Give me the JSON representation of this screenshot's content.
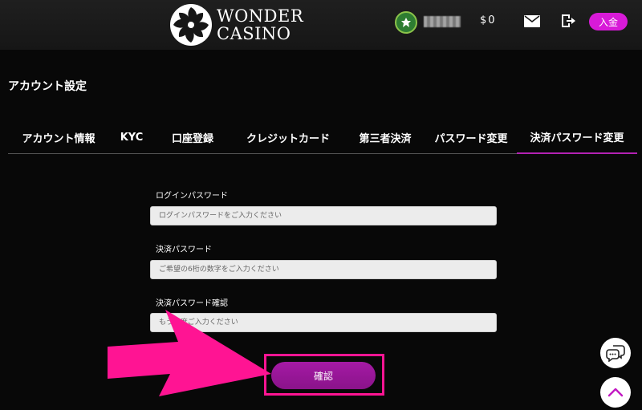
{
  "header": {
    "logo_line1": "WONDER",
    "logo_line2": "CASINO",
    "balance": "$0",
    "deposit_label": "入金"
  },
  "page": {
    "title": "アカウント設定"
  },
  "tabs": [
    {
      "label": "アカウント情報",
      "active": false
    },
    {
      "label": "KYC",
      "active": false
    },
    {
      "label": "口座登録",
      "active": false
    },
    {
      "label": "クレジットカード",
      "active": false
    },
    {
      "label": "第三者決済",
      "active": false
    },
    {
      "label": "パスワード変更",
      "active": false
    },
    {
      "label": "決済パスワード変更",
      "active": true
    }
  ],
  "form": {
    "login_password": {
      "label": "ログインパスワード",
      "placeholder": "ログインパスワードをご入力ください"
    },
    "payment_password": {
      "label": "決済パスワード",
      "placeholder": "ご希望の6桁の数字をご入力ください"
    },
    "payment_password_confirm": {
      "label": "決済パスワード確認",
      "placeholder": "もう一度ご入力ください"
    },
    "confirm_label": "確認"
  },
  "colors": {
    "accent": "#d81ad8",
    "button": "#a51aa5",
    "highlight": "#ff1493",
    "background": "#080808"
  },
  "icons": {
    "mail": "mail-icon",
    "logout": "logout-icon",
    "chat": "chat-icon",
    "scroll_top": "chevron-up-icon"
  }
}
